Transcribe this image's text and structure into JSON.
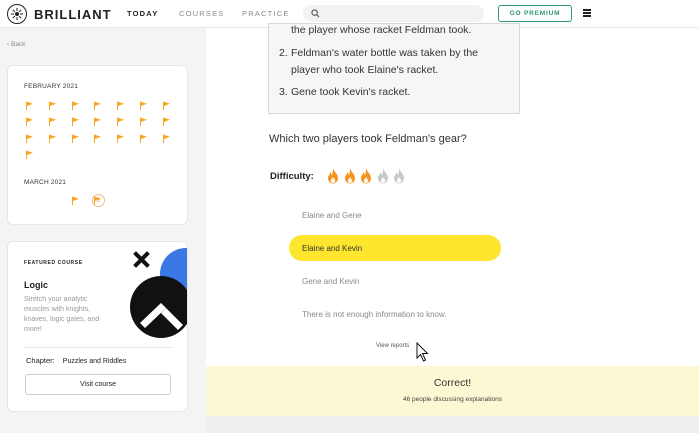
{
  "app": {
    "name": "BRILLIANT"
  },
  "nav": {
    "items": [
      {
        "label": "TODAY",
        "active": true
      },
      {
        "label": "COURSES",
        "active": false
      },
      {
        "label": "PRACTICE",
        "active": false
      }
    ]
  },
  "search": {
    "placeholder": "",
    "value": ""
  },
  "header": {
    "premium_label": "GO PREMIUM"
  },
  "sidebar": {
    "back_label": "Back",
    "calendar": {
      "months": [
        {
          "label": "FEBRUARY 2021",
          "completed_days": 22
        },
        {
          "label": "MARCH 2021",
          "completed_days": 2,
          "today_label": "3"
        }
      ]
    },
    "featured": {
      "eyebrow": "FEATURED COURSE",
      "title": "Logic",
      "description": "Stretch your analytic muscles with knights, knaves, logic gates, and more!",
      "chapter_label": "Chapter:",
      "chapter_name": "Puzzles and Riddles",
      "button_label": "Visit course"
    }
  },
  "problem": {
    "clues": [
      {
        "number": "",
        "text": "the player whose racket Feldman took."
      },
      {
        "number": "2.",
        "line1": "Feldman's water bottle was taken by the",
        "line2": "player who took Elaine's racket."
      },
      {
        "number": "3.",
        "text": "Gene took Kevin's racket."
      }
    ],
    "question": "Which two players took Feldman's gear?",
    "difficulty_label": "Difficulty:",
    "difficulty": {
      "level": 3,
      "max": 5
    },
    "options": [
      {
        "label": "Elaine and Gene",
        "selected": false
      },
      {
        "label": "Elaine and Kevin",
        "selected": true
      },
      {
        "label": "Gene and Kevin",
        "selected": false
      },
      {
        "label": "There is not enough information to know.",
        "selected": false
      }
    ],
    "view_reports_label": "View reports",
    "result": {
      "title": "Correct!",
      "subtitle": "46 people discussing explanations"
    }
  },
  "colors": {
    "accent_green": "#2c9a6e",
    "flag_orange": "#f5a623",
    "selected_yellow": "#ffe62e",
    "result_bg": "#fbf8d3",
    "flame_active": "#f5931e",
    "flame_inactive": "#c9c9c9"
  },
  "icons": {
    "logo": "brilliant-logo-icon",
    "search": "search-icon",
    "menu": "hamburger-menu-icon",
    "flag": "flag-icon",
    "flame": "flame-icon",
    "cursor": "mouse-pointer-icon"
  }
}
